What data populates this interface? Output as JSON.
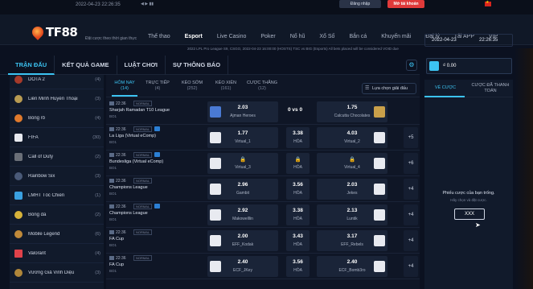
{
  "topbar": {
    "datetime": "2022-04-23 22:26:35",
    "login": "Đăng nhập",
    "register": "Mở tài khoản"
  },
  "brand": {
    "logo": "TF88",
    "tagline": "Đặt cược theo thời gian thực"
  },
  "menu": [
    "Thể thao",
    "Esport",
    "Live Casino",
    "Poker",
    "Nổ hũ",
    "Xổ Số",
    "Bắn cá",
    "Khuyến mãi",
    "Đại lý",
    "Tải APP",
    "VIP"
  ],
  "menu_active": "Esport",
  "ticker": "2022 LPL Pro League S9, CSGO, 2022-04-23 16:00:00 (HOSTS) TSC vs BIG (Esports) All bets placed will be considered VOID due",
  "clock": {
    "date": "2022-04-23",
    "time": "22:26:35"
  },
  "balance": "₫ 0.00",
  "tabs": [
    "TRẬN ĐẤU",
    "KẾT QUẢ GAME",
    "LUẬT CHƠI",
    "SỰ THÔNG BÁO"
  ],
  "sidebar": [
    {
      "label": "DOTA 2",
      "count": "(4)"
    },
    {
      "label": "Liên Minh Huyền Thoại",
      "count": "(3)"
    },
    {
      "label": "Bóng rổ",
      "count": "(4)"
    },
    {
      "label": "FIFA",
      "count": "(30)"
    },
    {
      "label": "Call of Duty",
      "count": "(2)"
    },
    {
      "label": "Rainbow Six",
      "count": "(3)"
    },
    {
      "label": "LMHT Tốc Chiến",
      "count": "(1)"
    },
    {
      "label": "Bóng đá",
      "count": "(2)"
    },
    {
      "label": "Mobile Legend",
      "count": "(6)"
    },
    {
      "label": "Valorant",
      "count": "(4)"
    },
    {
      "label": "Vương Giả Vinh Diệu",
      "count": "(3)"
    }
  ],
  "subtabs": [
    {
      "label": "HÔM NAY",
      "count": "(14)"
    },
    {
      "label": "TRỰC TIẾP",
      "count": "(4)"
    },
    {
      "label": "KÈO SỚM",
      "count": "(252)"
    },
    {
      "label": "KÈO XIÊN",
      "count": "(161)"
    },
    {
      "label": "CƯỢC THẮNG",
      "count": "(12)"
    }
  ],
  "filter_label": "Lựa chọn giải đấu",
  "matches": [
    {
      "time": "22:36",
      "tag": "NORMAL",
      "league": "Sharjah Ramadan T10 League",
      "bo": "BO1",
      "home_odd": "2.03",
      "home": "Ajman Heroes",
      "score": "0 vs 0",
      "away_odd": "1.75",
      "away": "Calcutta Chocolates",
      "draw_odd": "",
      "draw": "",
      "more": ""
    },
    {
      "time": "22:36",
      "tag": "NORMAL",
      "league": "La Liga (Virtual eComp)",
      "bo": "BO1",
      "home_odd": "1.77",
      "home": "Virtual_1",
      "score": "",
      "away_odd": "4.03",
      "away": "Virtual_2",
      "draw_odd": "3.38",
      "draw": "HÒA",
      "more": "+5"
    },
    {
      "time": "22:36",
      "tag": "NORMAL",
      "league": "Bundesliga (Virtual eComp)",
      "bo": "BO1",
      "home_odd": "🔒",
      "home": "Virtual_3",
      "score": "",
      "away_odd": "🔒",
      "away": "Virtual_4",
      "draw_odd": "🔒",
      "draw": "HÒA",
      "more": "+6"
    },
    {
      "time": "22:36",
      "tag": "NORMAL",
      "league": "Champions League",
      "bo": "BO1",
      "home_odd": "2.96",
      "home": "Gambit",
      "score": "",
      "away_odd": "2.03",
      "away": "Jekes",
      "draw_odd": "3.56",
      "draw": "HÒA",
      "more": "+4"
    },
    {
      "time": "22:36",
      "tag": "NORMAL",
      "league": "Champions League",
      "bo": "BO1",
      "home_odd": "2.92",
      "home": "Makowelllin",
      "score": "",
      "away_odd": "2.13",
      "away": "Luntik",
      "draw_odd": "3.38",
      "draw": "HÒA",
      "more": "+4"
    },
    {
      "time": "22:36",
      "tag": "NORMAL",
      "league": "FA Cup",
      "bo": "BO1",
      "home_odd": "2.00",
      "home": "EFF_Kodak",
      "score": "",
      "away_odd": "3.17",
      "away": "EFF_Rebels",
      "draw_odd": "3.43",
      "draw": "HÒA",
      "more": "+4"
    },
    {
      "time": "22:36",
      "tag": "NORMAL",
      "league": "FA Cup",
      "bo": "BO1",
      "home_odd": "2.40",
      "home": "ECF_JKey",
      "score": "",
      "away_odd": "2.40",
      "away": "ECF_Bomb3ro",
      "draw_odd": "3.56",
      "draw": "HÒA",
      "more": "+4"
    }
  ],
  "slip": {
    "tab1": "VÉ CƯỢC",
    "tab2": "CƯỢC ĐÃ THANH TOÁN",
    "empty": "Phiếu cược của bạn trống.",
    "sub": "Hãy chọn và đặt cược.",
    "button": "XXX"
  },
  "colors": {
    "accent": "#3cc3f2",
    "register": "#e03a3a",
    "bg": "#0b1120"
  }
}
